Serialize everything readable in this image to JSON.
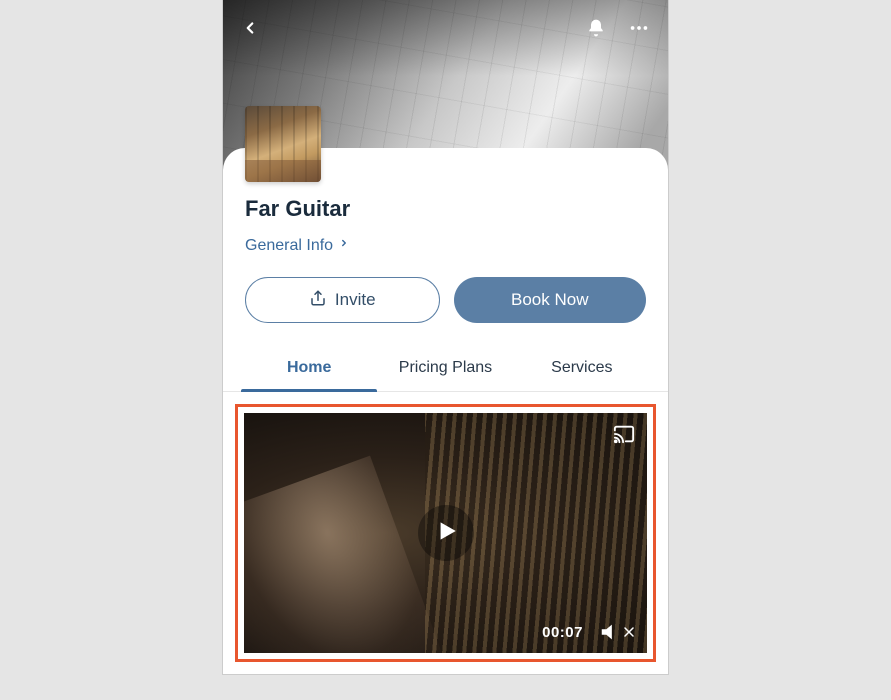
{
  "page": {
    "title": "Far Guitar",
    "general_info_label": "General Info"
  },
  "actions": {
    "invite_label": "Invite",
    "book_label": "Book Now"
  },
  "tabs": {
    "home": "Home",
    "pricing": "Pricing Plans",
    "services": "Services",
    "active": "home"
  },
  "video": {
    "timecode": "00:07",
    "muted": true
  },
  "icons": {
    "back": "back-chevron",
    "bell": "notification-bell",
    "more": "more-dots",
    "share": "share-up",
    "chevron_right": "chevron-right",
    "play": "play-triangle",
    "cast": "cast-screen",
    "mute": "speaker-muted"
  },
  "colors": {
    "accent": "#3a6a9c",
    "primary_button": "#5b7fa5",
    "highlight_border": "#e8562e"
  }
}
